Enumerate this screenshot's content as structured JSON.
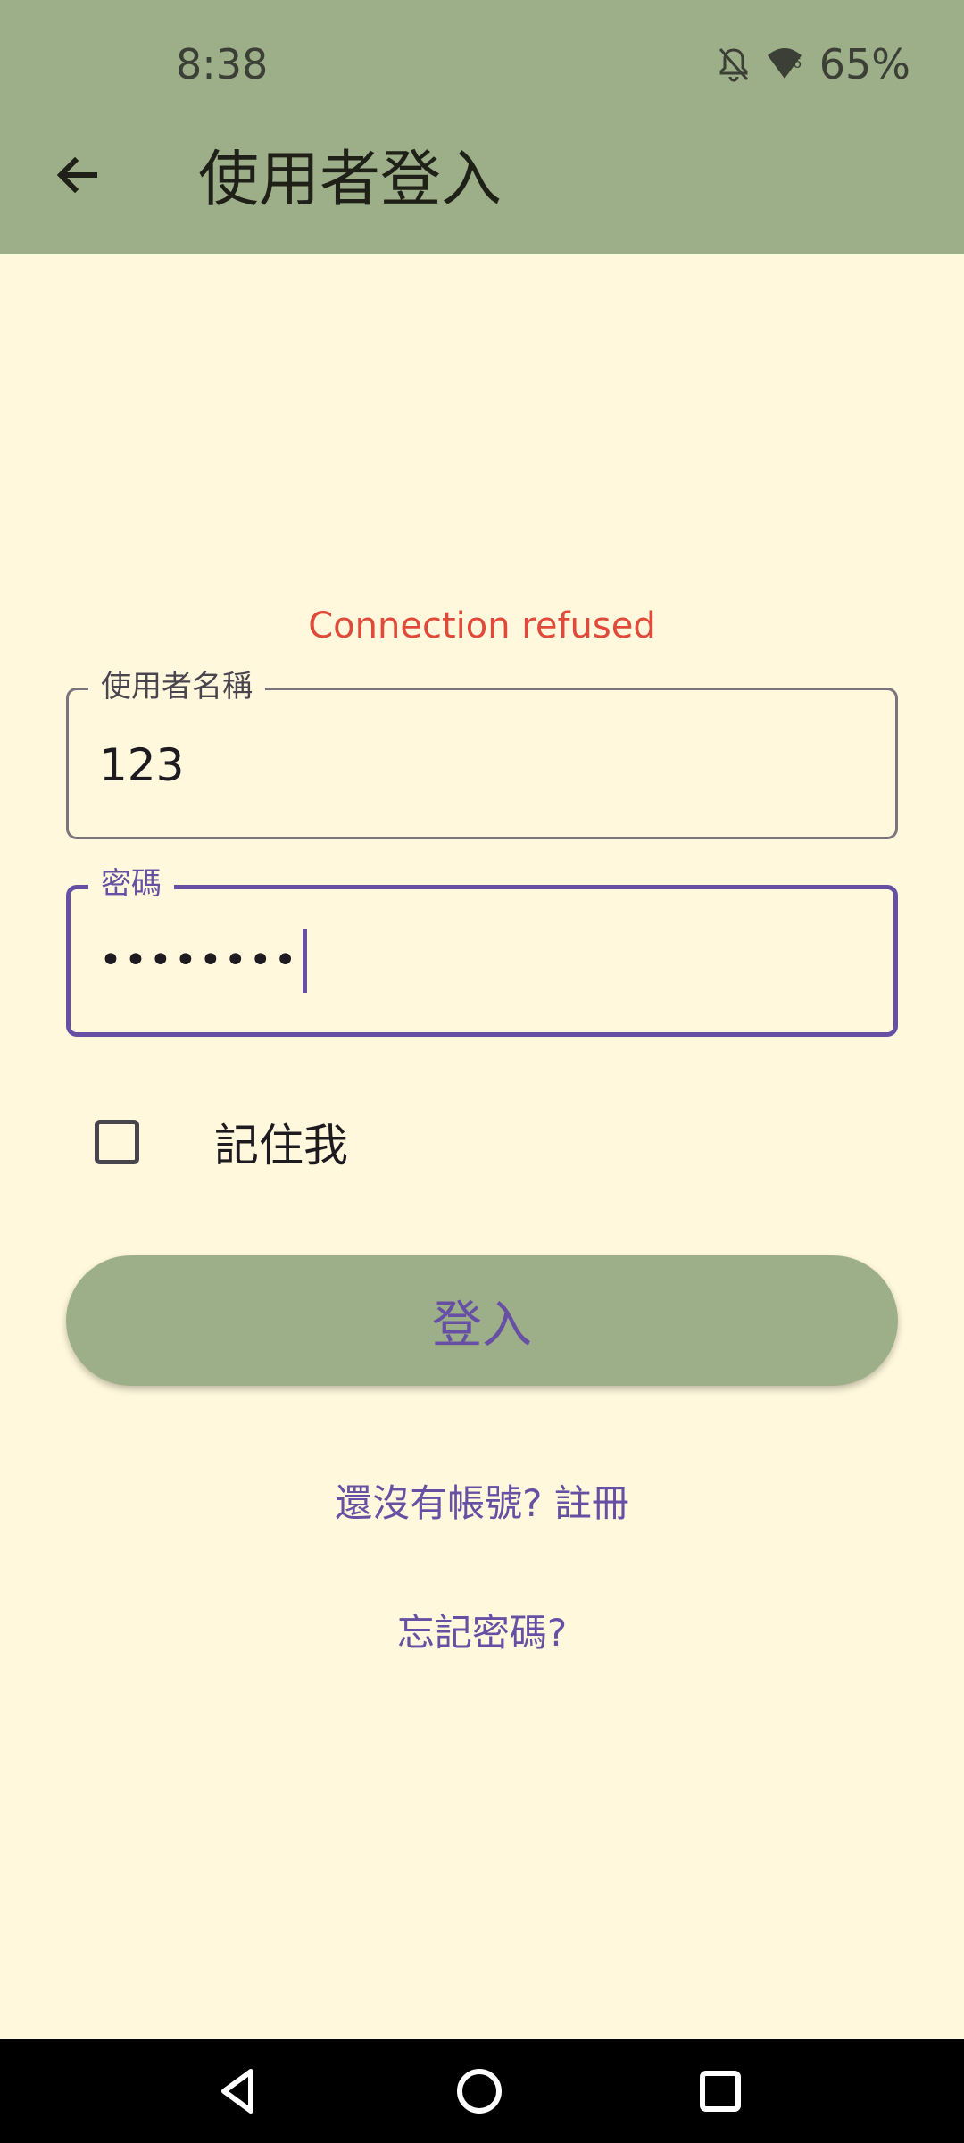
{
  "status_bar": {
    "time": "8:38",
    "battery": "65%",
    "icons": [
      "notifications-off-icon",
      "wifi-icon",
      "battery-icon"
    ]
  },
  "app_bar": {
    "title": "使用者登入",
    "back_icon": "arrow-back-icon"
  },
  "login": {
    "error_message": "Connection refused",
    "username": {
      "label": "使用者名稱",
      "value": "123"
    },
    "password": {
      "label": "密碼",
      "value": "••••••••"
    },
    "remember_me": {
      "label": "記住我",
      "checked": false
    },
    "submit_label": "登入",
    "register_link": "還沒有帳號? 註冊",
    "forgot_link": "忘記密碼?"
  },
  "nav_bar": {
    "icons": [
      "back-triangle-icon",
      "home-circle-icon",
      "recents-square-icon"
    ]
  },
  "colors": {
    "app_bar": "#9daf89",
    "background": "#fff8dc",
    "accent": "#6750a4",
    "error": "#e04a3b"
  }
}
